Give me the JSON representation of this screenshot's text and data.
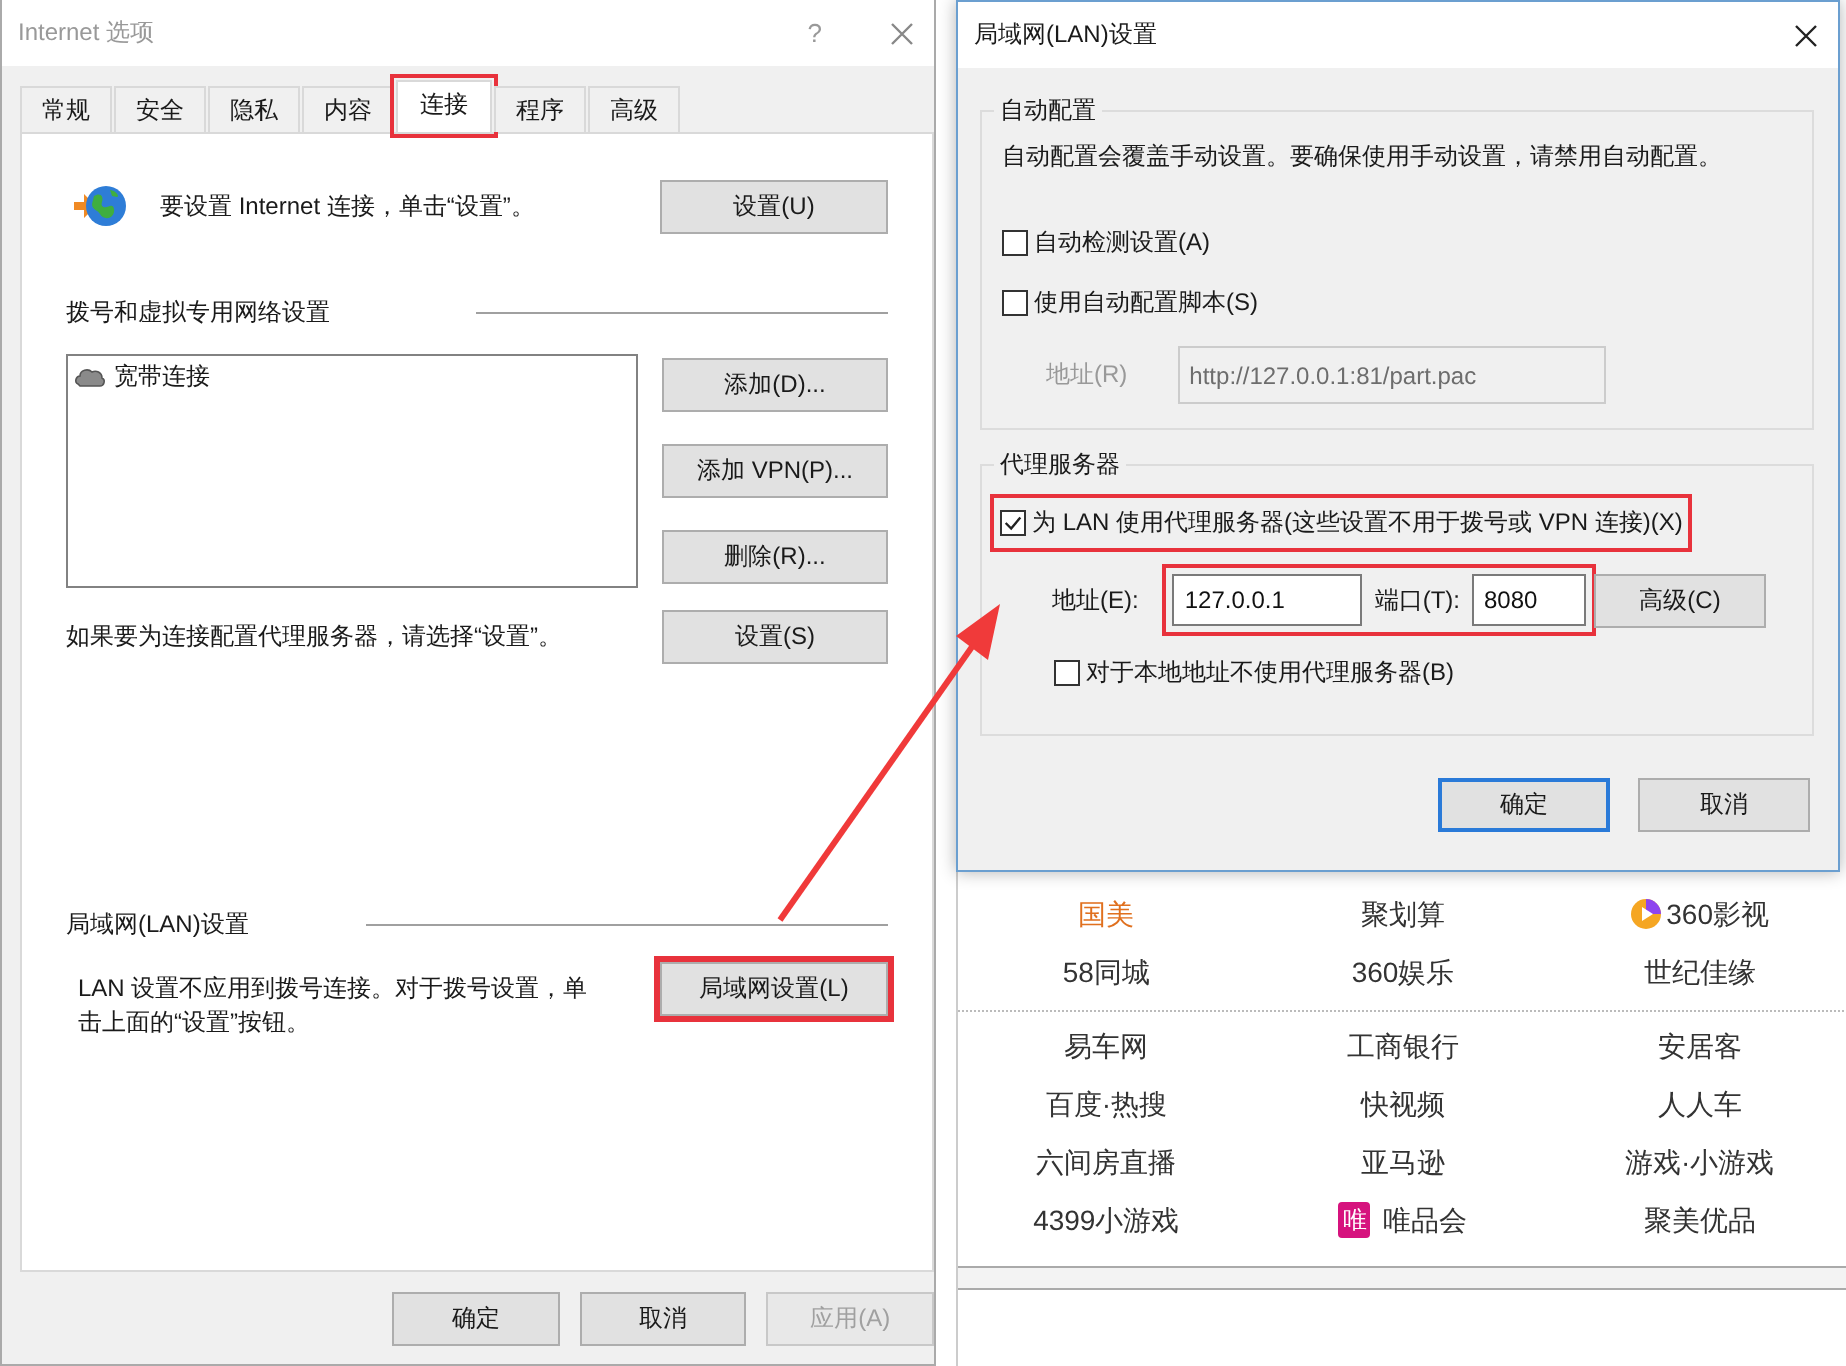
{
  "internet_options": {
    "title": "Internet 选项",
    "help": "?",
    "tabs": [
      {
        "label": "常规",
        "selected": false,
        "highlighted": false
      },
      {
        "label": "安全",
        "selected": false,
        "highlighted": false
      },
      {
        "label": "隐私",
        "selected": false,
        "highlighted": false
      },
      {
        "label": "内容",
        "selected": false,
        "highlighted": false
      },
      {
        "label": "连接",
        "selected": true,
        "highlighted": true
      },
      {
        "label": "程序",
        "selected": false,
        "highlighted": false
      },
      {
        "label": "高级",
        "selected": false,
        "highlighted": false
      }
    ],
    "setup": {
      "text": "要设置 Internet 连接，单击“设置”。",
      "button": "设置(U)"
    },
    "dialup": {
      "heading": "拨号和虚拟专用网络设置",
      "connections": [
        "宽带连接"
      ],
      "buttons": [
        "添加(D)...",
        "添加 VPN(P)...",
        "删除(R)..."
      ],
      "proxy_note": "如果要为连接配置代理服务器，请选择“设置”。",
      "proxy_button": "设置(S)"
    },
    "lan": {
      "heading": "局域网(LAN)设置",
      "note": "LAN 设置不应用到拨号连接。对于拨号设置，单击上面的“设置”按钮。",
      "button": {
        "label": "局域网设置(L)",
        "highlighted": true
      }
    },
    "footer": [
      {
        "label": "确定",
        "disabled": false
      },
      {
        "label": "取消",
        "disabled": false
      },
      {
        "label": "应用(A)",
        "disabled": true
      }
    ]
  },
  "lan_settings": {
    "title": "局域网(LAN)设置",
    "auto": {
      "heading": "自动配置",
      "note": "自动配置会覆盖手动设置。要确保使用手动设置，请禁用自动配置。",
      "options": [
        {
          "label": "自动检测设置(A)",
          "checked": false
        },
        {
          "label": "使用自动配置脚本(S)",
          "checked": false
        }
      ],
      "script_address": {
        "label": "地址(R)",
        "value": "http://127.0.0.1:81/part.pac",
        "disabled": true
      }
    },
    "proxy": {
      "heading": "代理服务器",
      "use_proxy": {
        "label": "为 LAN 使用代理服务器(这些设置不用于拨号或 VPN 连接)(X)",
        "checked": true,
        "highlighted": true
      },
      "address": {
        "label": "地址(E):",
        "value": "127.0.0.1"
      },
      "port": {
        "label": "端口(T):",
        "value": "8080"
      },
      "fields_highlighted": true,
      "advanced": "高级(C)",
      "bypass_local": {
        "label": "对于本地地址不使用代理服务器(B)",
        "checked": false
      }
    },
    "buttons": [
      {
        "label": "确定",
        "default": true
      },
      {
        "label": "取消",
        "default": false
      }
    ]
  },
  "web_links": {
    "groups": [
      [
        {
          "label": "国美",
          "color": "#e0701e",
          "kind": "plain"
        },
        {
          "label": "聚划算",
          "color": "#333333",
          "kind": "plain"
        },
        {
          "label": "360影视",
          "color": "#333333",
          "kind": "play"
        },
        {
          "label": "58同城",
          "color": "#333333",
          "kind": "plain"
        },
        {
          "label": "360娱乐",
          "color": "#333333",
          "kind": "plain"
        },
        {
          "label": "世纪佳缘",
          "color": "#333333",
          "kind": "plain"
        }
      ],
      [
        {
          "label": "易车网",
          "color": "#333333",
          "kind": "plain"
        },
        {
          "label": "工商银行",
          "color": "#333333",
          "kind": "plain"
        },
        {
          "label": "安居客",
          "color": "#333333",
          "kind": "plain"
        },
        {
          "label": "百度·热搜",
          "color": "#333333",
          "kind": "plain"
        },
        {
          "label": "快视频",
          "color": "#333333",
          "kind": "plain"
        },
        {
          "label": "人人车",
          "color": "#333333",
          "kind": "plain"
        },
        {
          "label": "六间房直播",
          "color": "#333333",
          "kind": "plain"
        },
        {
          "label": "亚马逊",
          "color": "#333333",
          "kind": "plain"
        },
        {
          "label": "游戏·小游戏",
          "color": "#333333",
          "kind": "plain"
        },
        {
          "label": "4399小游戏",
          "color": "#333333",
          "kind": "plain"
        },
        {
          "label": "唯品会",
          "color": "#333333",
          "kind": "badge",
          "badge": "唯"
        },
        {
          "label": "聚美优品",
          "color": "#333333",
          "kind": "plain"
        }
      ]
    ]
  }
}
